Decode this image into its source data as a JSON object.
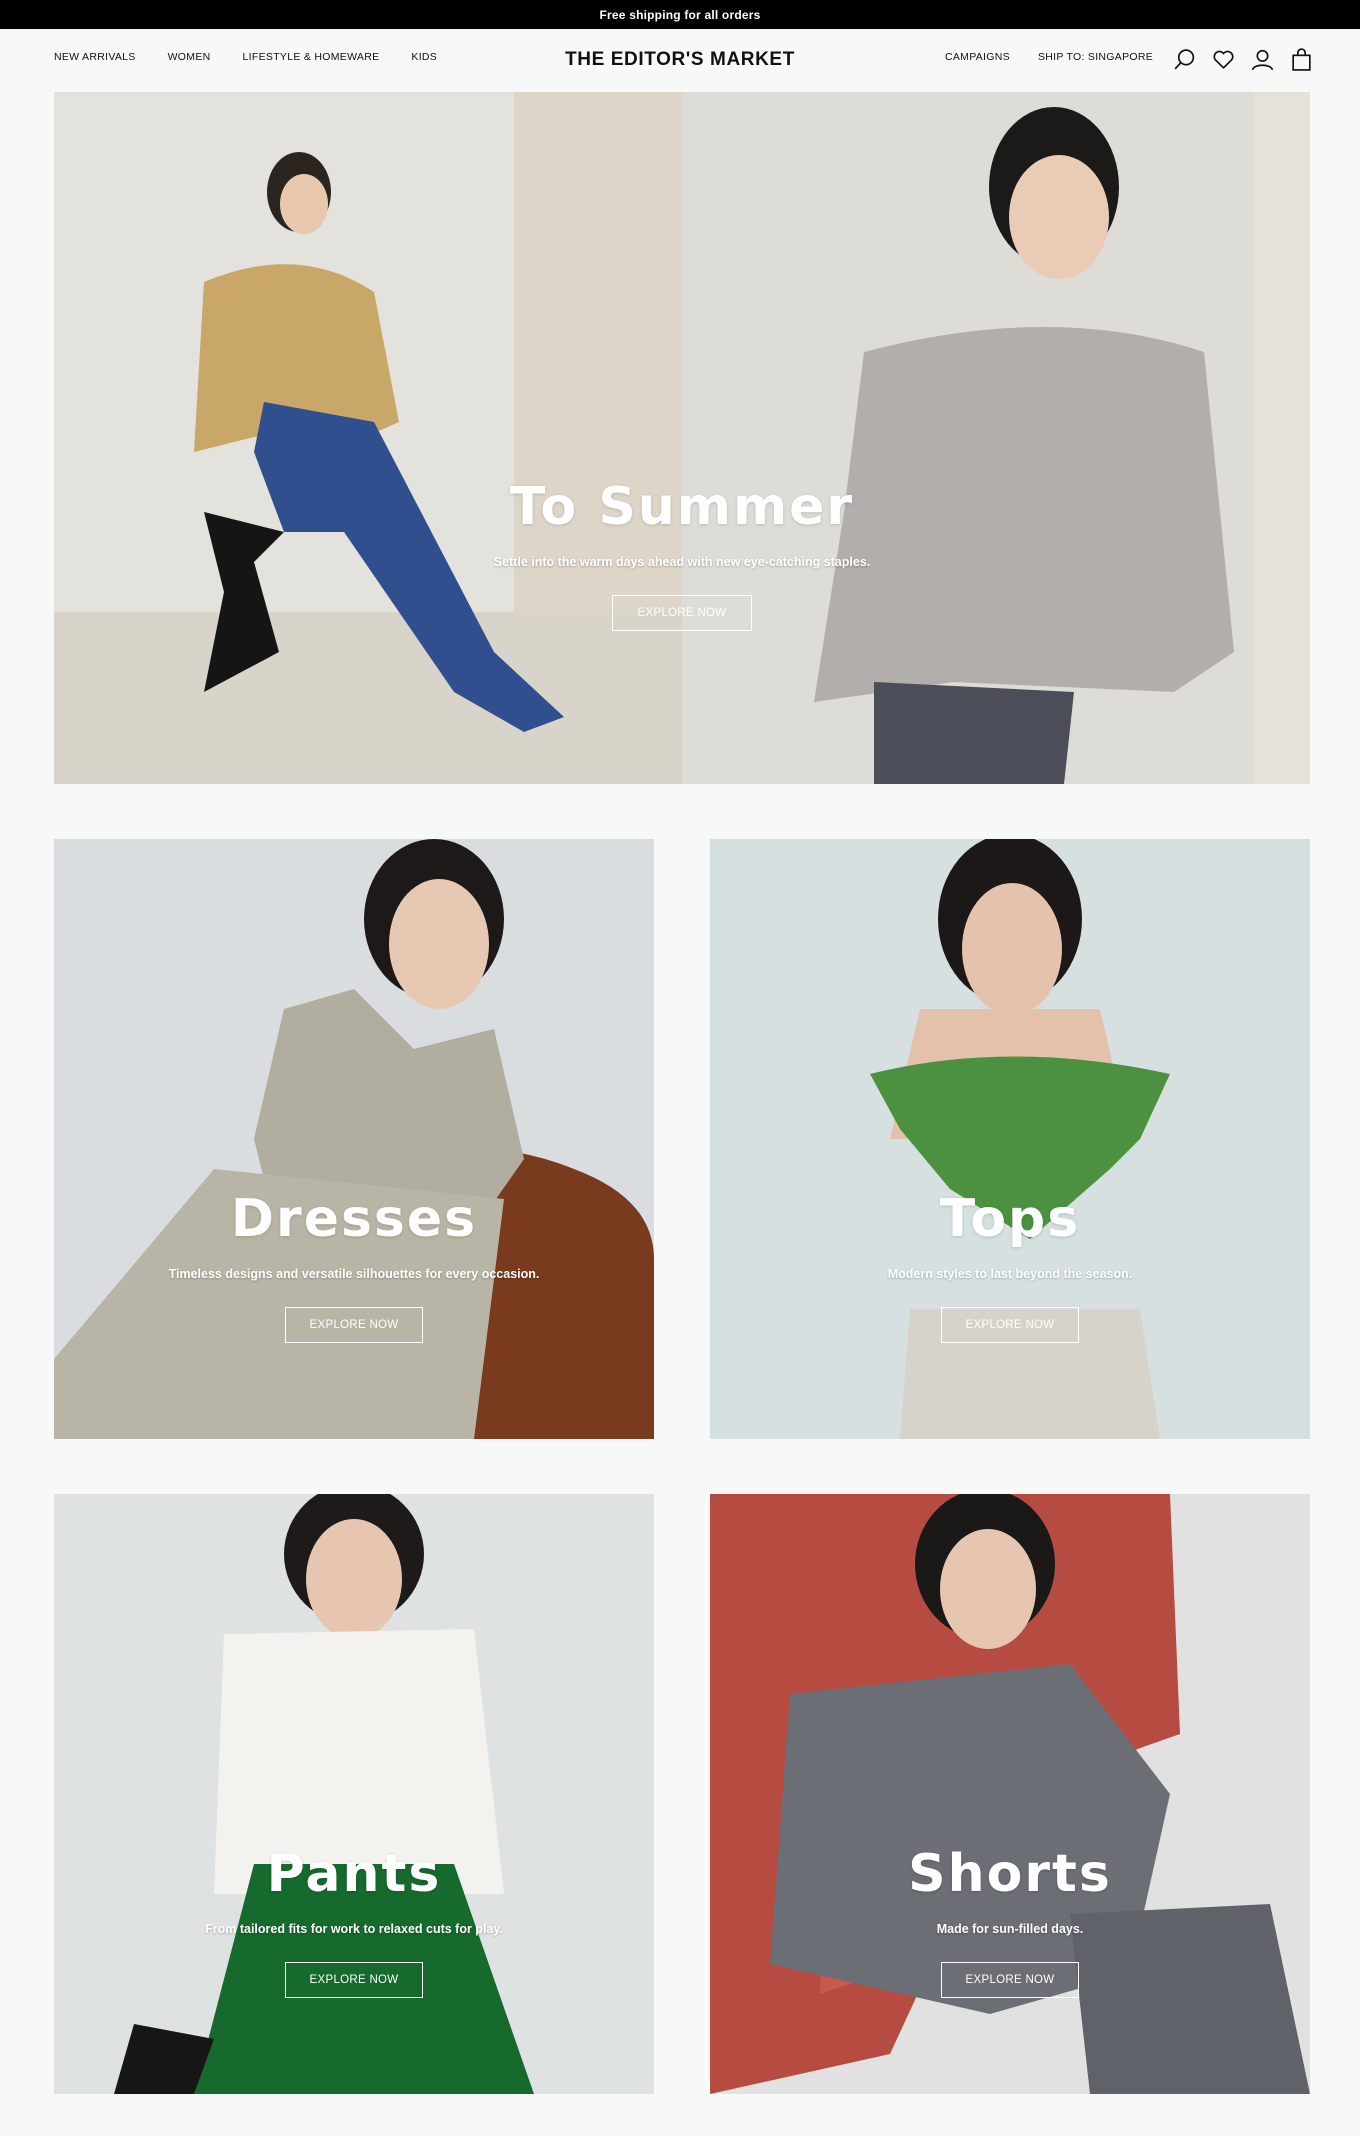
{
  "announcement": "Free shipping for all orders",
  "header": {
    "nav_left": [
      "NEW ARRIVALS",
      "WOMEN",
      "LIFESTYLE & HOMEWARE",
      "KIDS"
    ],
    "logo": "THE EDITOR'S MARKET",
    "campaigns": "CAMPAIGNS",
    "ship_to": "SHIP TO: SINGAPORE",
    "icons": [
      "search-icon",
      "heart-icon",
      "user-icon",
      "bag-icon"
    ]
  },
  "hero": {
    "title": "To Summer",
    "subtitle": "Settle into the warm days ahead with new eye-catching staples.",
    "cta": "EXPLORE NOW"
  },
  "categories": [
    {
      "title": "Dresses",
      "subtitle": "Timeless designs and versatile silhouettes for every occasion.",
      "cta": "EXPLORE NOW"
    },
    {
      "title": "Tops",
      "subtitle": "Modern styles to last beyond the season.",
      "cta": "EXPLORE NOW"
    },
    {
      "title": "Pants",
      "subtitle": "From tailored fits for work to relaxed cuts for play.",
      "cta": "EXPLORE NOW"
    },
    {
      "title": "Shorts",
      "subtitle": "Made for sun-filled days.",
      "cta": "EXPLORE NOW"
    }
  ]
}
